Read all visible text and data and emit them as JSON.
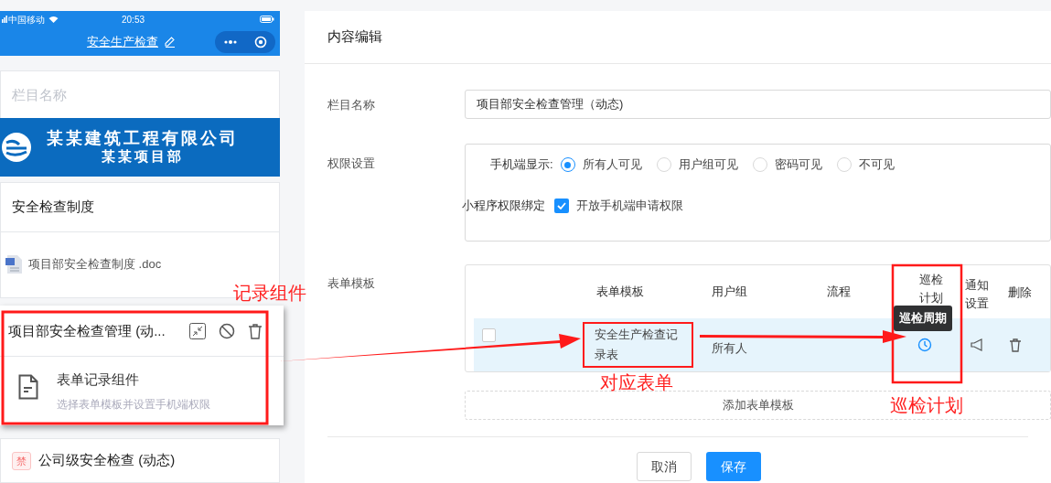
{
  "phone": {
    "status_bar": {
      "carrier": "中国移动",
      "time": "20:53"
    },
    "title": "安全生产检查",
    "column_name_placeholder": "栏目名称",
    "banner": {
      "company": "某某建筑工程有限公司",
      "project": "某某项目部"
    },
    "sections": [
      {
        "kind": "heading",
        "title": "安全检查制度"
      },
      {
        "kind": "file",
        "name": "项目部安全检查制度 .doc"
      },
      {
        "kind": "component",
        "title": "项目部安全检查管理 (动...",
        "component": "表单记录组件",
        "hint": "选择表单模板并设置手机端权限",
        "selected": true
      },
      {
        "kind": "item",
        "title": "公司级安全检查 (动态)",
        "badge": "禁"
      }
    ]
  },
  "editor": {
    "title": "内容编辑",
    "name_field": {
      "label": "栏目名称",
      "value": "项目部安全检查管理（动态)"
    },
    "permissions": {
      "label": "权限设置",
      "display_label": "手机端显示:",
      "options": [
        {
          "label": "所有人可见",
          "selected": true
        },
        {
          "label": "用户组可见",
          "selected": false
        },
        {
          "label": "密码可见",
          "selected": false
        },
        {
          "label": "不可见",
          "selected": false
        }
      ],
      "binding_label": "小程序权限绑定",
      "binding_option": {
        "label": "开放手机端申请权限",
        "checked": true
      }
    },
    "table": {
      "label": "表单模板",
      "columns": [
        "表单模板",
        "用户组",
        "流程",
        "巡检计划",
        "通知设置",
        "删除"
      ],
      "rows": [
        {
          "checked": false,
          "template": "安全生产检查记录表",
          "group": "所有人",
          "tooltip": "巡检周期"
        }
      ],
      "add_button": "添加表单模板"
    },
    "buttons": [
      {
        "label": "取消",
        "kind": "default"
      },
      {
        "label": "保存",
        "kind": "primary"
      }
    ]
  },
  "annotations": [
    {
      "text": "记录组件"
    },
    {
      "text": "对应表单"
    },
    {
      "text": "巡检计划"
    }
  ]
}
